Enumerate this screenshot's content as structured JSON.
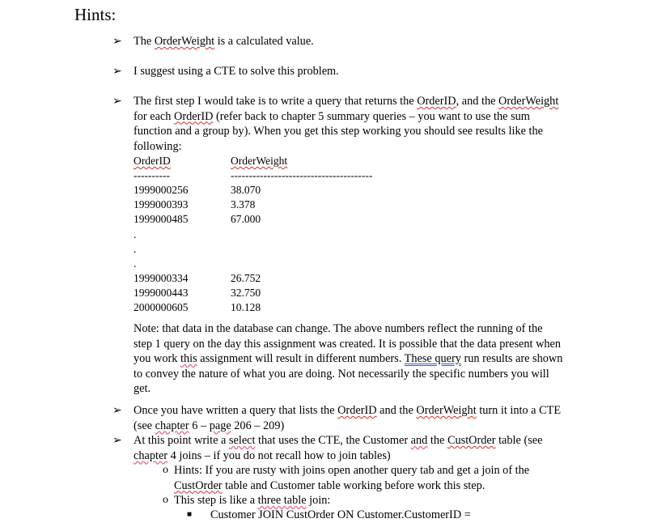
{
  "heading": "Hints:",
  "bullet_glyph": "➢",
  "sub_bullet_glyph": "o",
  "hints": {
    "h1": {
      "pre": "The ",
      "term": "OrderWeight",
      "post": " is a calculated value."
    },
    "h2": "I suggest using a CTE to solve this problem.",
    "h3": {
      "line1_pre": "The first step I would take is to write a query that returns the ",
      "line1_t1": "OrderID",
      "line1_mid": ", and the ",
      "line1_t2": "OrderWeight",
      "line2_pre": "for each ",
      "line2_t1": "OrderID",
      "line2_post": " (refer back to chapter 5 summary queries – you want to use the sum",
      "line3": "function and a group by).   When you get this step working you should see results like the",
      "line4": "following:"
    },
    "table": {
      "headers": [
        "OrderID",
        "OrderWeight"
      ],
      "separators": [
        "----------",
        "---------------------------------------"
      ],
      "rows_top": [
        [
          "1999000256",
          "38.070"
        ],
        [
          "1999000393",
          "3.378"
        ],
        [
          "1999000485",
          "67.000"
        ]
      ],
      "ellipsis": [
        ".",
        ".",
        "."
      ],
      "rows_bottom": [
        [
          "1999000334",
          "26.752"
        ],
        [
          "1999000443",
          "32.750"
        ],
        [
          "2000000605",
          "10.128"
        ]
      ]
    },
    "note": {
      "l1": "Note:  that data in the database can change.  The above numbers reflect the running of the",
      "l2": "step 1 query on the day this assignment was created.  It is possible that the data present when",
      "l3_pre": "you work ",
      "l3_this": "this",
      "l3_mid": " assignment will result in different numbers.   ",
      "l3_these": "These query",
      "l3_post": " run results are shown",
      "l4": "to convey the nature of what you are doing.  Not necessarily the specific numbers you will",
      "l5": "get."
    },
    "h4": {
      "l1_pre": "Once you have written a query that lists the ",
      "l1_t1": "OrderID",
      "l1_mid": " and the ",
      "l1_t2": "OrderWeight",
      "l1_post": "  turn it into a CTE",
      "l2_pre": "(see ",
      "l2_ch": "chapter",
      "l2_mid": " 6 – ",
      "l2_pg": "page",
      "l2_post": " 206 – 209)"
    },
    "h5": {
      "l1_pre": "At this point write a ",
      "l1_select": "select",
      "l1_mid": " that uses the CTE, the Customer ",
      "l1_and": "and",
      "l1_mid2": " the ",
      "l1_co": "CustOrder",
      "l1_post": " table (see",
      "l2_ch": "chapter",
      "l2_post": " 4 joins – if you do not recall how to join tables)"
    },
    "sub": {
      "s1_l1": "Hints:  If you are rusty with joins open another query tab and get a join of the",
      "s1_l2_co": "CustOrder",
      "s1_l2_post": " table and Customer table working before work this step.",
      "s2_pre": "This step is like a ",
      "s2_link": "three table",
      "s2_post": " join:",
      "s3": "Customer JOIN CustOrder ON Customer.CustomerID ="
    }
  }
}
